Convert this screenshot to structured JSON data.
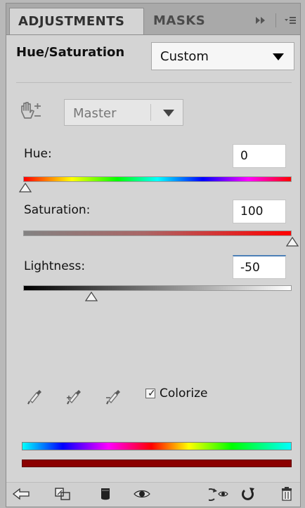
{
  "tabs": {
    "adjustments": "ADJUSTMENTS",
    "masks": "MASKS"
  },
  "header": {
    "title": "Hue/Saturation",
    "preset_value": "Custom"
  },
  "channel": {
    "value": "Master"
  },
  "sliders": {
    "hue": {
      "label": "Hue:",
      "value": "0"
    },
    "saturation": {
      "label": "Saturation:",
      "value": "100"
    },
    "lightness": {
      "label": "Lightness:",
      "value": "-50"
    }
  },
  "options": {
    "colorize_label": "Colorize",
    "colorize_checked": true
  },
  "icons": {
    "tab_tools": [
      "play-forward-icon",
      "panel-menu-icon"
    ],
    "targeted_adjustment": "hand-adjust-icon",
    "eyedroppers": [
      "eyedropper-icon",
      "eyedropper-plus-icon",
      "eyedropper-minus-icon"
    ],
    "footer": [
      "back-arrow-icon",
      "clip-to-layer-icon",
      "visibility-toggle-icon",
      "eye-icon",
      "view-previous-icon",
      "reset-icon",
      "delete-icon"
    ]
  },
  "colors": {
    "panel_bg": "#d4d4d4",
    "tab_bar_bg": "#a9a9a9",
    "result_bar": "#8b0000",
    "focus_border": "#4c7fb6"
  }
}
